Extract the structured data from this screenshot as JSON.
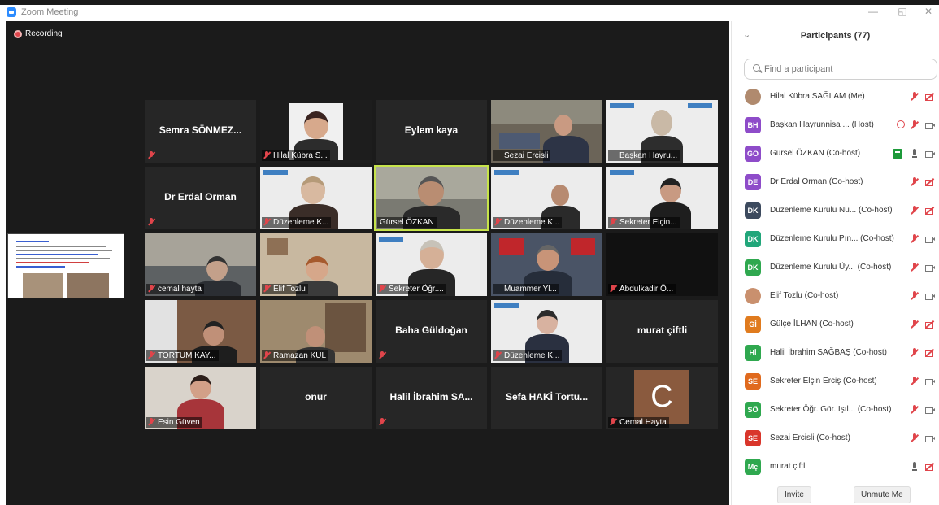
{
  "window": {
    "title": "Zoom Meeting",
    "minimize": "—",
    "restore": "◱",
    "close": "✕"
  },
  "recording": {
    "label": "Recording"
  },
  "tiles": [
    {
      "name": "Semra SÖNMEZ...",
      "label": ""
    },
    {
      "name": "",
      "label": "Hilal Kübra S..."
    },
    {
      "name": "Eylem kaya",
      "label": ""
    },
    {
      "name": "",
      "label": "Sezai Ercisli"
    },
    {
      "name": "",
      "label": "Başkan Hayru..."
    },
    {
      "name": "Dr Erdal Orman",
      "label": ""
    },
    {
      "name": "",
      "label": "Düzenleme K..."
    },
    {
      "name": "",
      "label": "Gürsel ÖZKAN"
    },
    {
      "name": "",
      "label": "Düzenleme K..."
    },
    {
      "name": "",
      "label": "Sekreter Elçin..."
    },
    {
      "name": "",
      "label": "cemal hayta"
    },
    {
      "name": "",
      "label": "Elif Tozlu"
    },
    {
      "name": "",
      "label": "Sekreter Öğr...."
    },
    {
      "name": "",
      "label": "Muammer Yl..."
    },
    {
      "name": "",
      "label": "Abdulkadir Ö..."
    },
    {
      "name": "",
      "label": "TORTUM KAY..."
    },
    {
      "name": "",
      "label": "Ramazan KUL"
    },
    {
      "name": "Baha Güldoğan",
      "label": ""
    },
    {
      "name": "",
      "label": "Düzenleme K..."
    },
    {
      "name": "murat çiftli",
      "label": ""
    },
    {
      "name": "",
      "label": "Esin Güven"
    },
    {
      "name": "onur",
      "label": ""
    },
    {
      "name": "Halil İbrahim SA...",
      "label": ""
    },
    {
      "name": "Sefa HAKİ Tortu...",
      "label": ""
    },
    {
      "name": "",
      "label": "Cemal Hayta",
      "avatar_letter": "C"
    }
  ],
  "panel": {
    "title": "Participants (77)",
    "collapse": "⌄",
    "search_placeholder": "Find a participant",
    "participants": [
      {
        "initials": "",
        "color": "#b08a6e",
        "name": "Hilal Kübra SAĞLAM (Me)",
        "mic": "muted",
        "cam": "off"
      },
      {
        "initials": "BH",
        "color": "#8e4cc9",
        "name": "Başkan Hayrunnisa ...  (Host)",
        "mic": "muted",
        "cam": "on",
        "host_icon": true
      },
      {
        "initials": "GÖ",
        "color": "#8e4cc9",
        "name": "Gürsel ÖZKAN (Co-host)",
        "mic": "on",
        "cam": "on",
        "sharing": true
      },
      {
        "initials": "DE",
        "color": "#8e4cc9",
        "name": "Dr Erdal Orman (Co-host)",
        "mic": "muted",
        "cam": "off"
      },
      {
        "initials": "DK",
        "color": "#3c4a5e",
        "name": "Düzenleme Kurulu Nu... (Co-host)",
        "mic": "muted",
        "cam": "off"
      },
      {
        "initials": "DK",
        "color": "#21a67a",
        "name": "Düzenleme Kurulu Pın... (Co-host)",
        "mic": "muted",
        "cam": "on"
      },
      {
        "initials": "DK",
        "color": "#2fa84f",
        "name": "Düzenleme Kurulu Üy... (Co-host)",
        "mic": "muted",
        "cam": "on"
      },
      {
        "initials": "",
        "color": "#c9906e",
        "name": "Elif Tozlu (Co-host)",
        "mic": "muted",
        "cam": "on"
      },
      {
        "initials": "Gİ",
        "color": "#e07b1e",
        "name": "Gülçe İLHAN (Co-host)",
        "mic": "muted",
        "cam": "off"
      },
      {
        "initials": "Hİ",
        "color": "#2fa84f",
        "name": "Halil İbrahim SAĞBAŞ (Co-host)",
        "mic": "muted",
        "cam": "off"
      },
      {
        "initials": "SE",
        "color": "#e06a1e",
        "name": "Sekreter Elçin Erciş (Co-host)",
        "mic": "muted",
        "cam": "on"
      },
      {
        "initials": "SÖ",
        "color": "#2fa84f",
        "name": "Sekreter Öğr. Gör. Işıl... (Co-host)",
        "mic": "muted",
        "cam": "on"
      },
      {
        "initials": "SE",
        "color": "#d9362b",
        "name": "Sezai Ercisli (Co-host)",
        "mic": "muted",
        "cam": "on"
      },
      {
        "initials": "Mç",
        "color": "#2fa84f",
        "name": "murat çiftli",
        "mic": "on",
        "cam": "off"
      }
    ],
    "invite_label": "Invite",
    "unmute_label": "Unmute Me"
  }
}
